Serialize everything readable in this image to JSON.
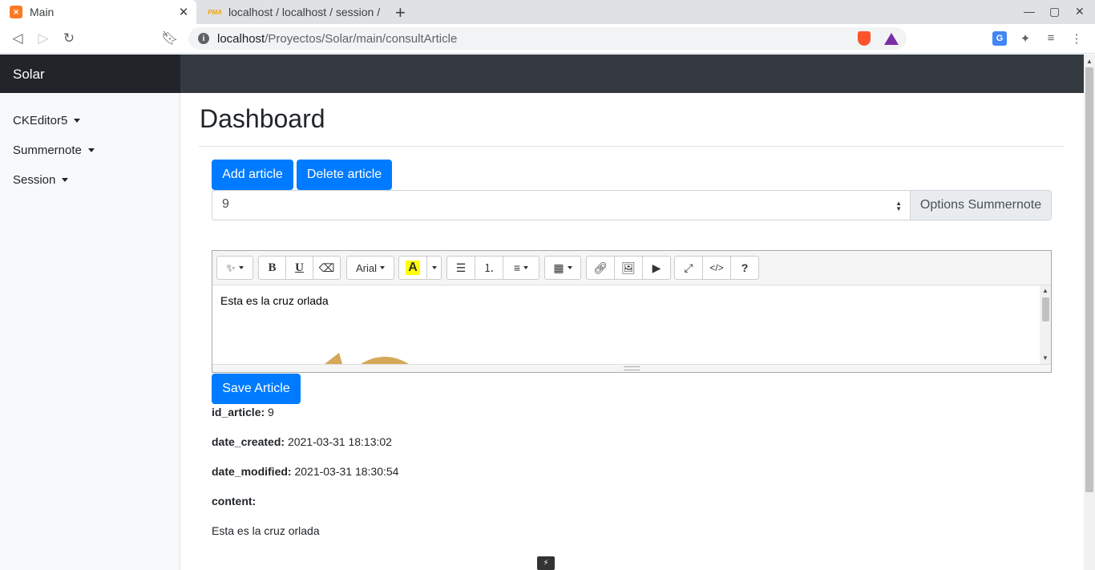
{
  "browser": {
    "tabs": [
      {
        "title": "Main",
        "favicon": "xampp-icon"
      },
      {
        "title": "localhost / localhost / session /",
        "favicon": "phpmyadmin-icon"
      }
    ],
    "url_host": "localhost",
    "url_path": "/Proyectos/Solar/main/consultArticle"
  },
  "app": {
    "brand": "Solar",
    "sidebar": {
      "items": [
        {
          "label": "CKEditor5"
        },
        {
          "label": "Summernote"
        },
        {
          "label": "Session"
        }
      ]
    },
    "page_title": "Dashboard",
    "buttons": {
      "add_article": "Add article",
      "delete_article": "Delete article",
      "save_article": "Save Article"
    },
    "select": {
      "value": "9",
      "addon": "Options Summernote"
    },
    "editor": {
      "font_name": "Arial",
      "content": "Esta es la cruz orlada",
      "highlight_color": "#ffff00"
    },
    "article": {
      "id_label": "id_article:",
      "id_value": "9",
      "created_label": "date_created:",
      "created_value": "2021-03-31 18:13:02",
      "modified_label": "date_modified:",
      "modified_value": "2021-03-31 18:30:54",
      "content_label": "content:",
      "content_value": "Esta es la cruz orlada"
    }
  },
  "colors": {
    "primary": "#007bff",
    "navbar": "#343a40",
    "brand_bg": "#212529"
  }
}
